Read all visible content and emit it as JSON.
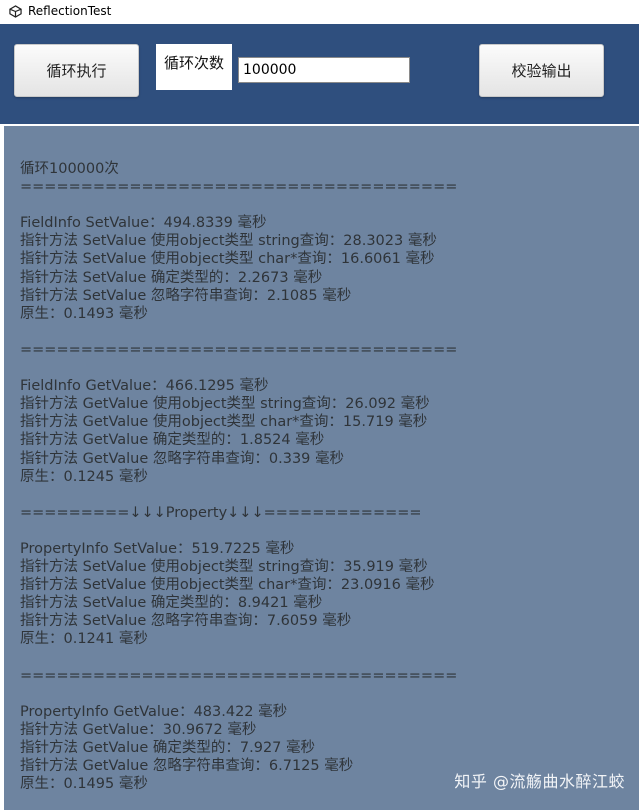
{
  "window": {
    "title": "ReflectionTest",
    "icon": "unity-logo-icon"
  },
  "toolbar": {
    "run_label": "循环执行",
    "count_label": "循环次数",
    "count_value": "100000",
    "verify_label": "校验输出"
  },
  "output": {
    "lines": [
      "循环100000次",
      "====================================",
      "",
      "FieldInfo SetValue：494.8339 毫秒",
      "指针方法 SetValue 使用object类型 string查询：28.3023 毫秒",
      "指针方法 SetValue 使用object类型 char*查询：16.6061 毫秒",
      "指针方法 SetValue 确定类型的：2.2673 毫秒",
      "指针方法 SetValue 忽略字符串查询：2.1085 毫秒",
      "原生：0.1493 毫秒",
      "",
      "====================================",
      "",
      "FieldInfo GetValue：466.1295 毫秒",
      "指针方法 GetValue 使用object类型 string查询：26.092 毫秒",
      "指针方法 GetValue 使用object类型 char*查询：15.719 毫秒",
      "指针方法 GetValue 确定类型的：1.8524 毫秒",
      "指针方法 GetValue 忽略字符串查询：0.339 毫秒",
      "原生：0.1245 毫秒",
      "",
      "=========↓↓↓Property↓↓↓=============",
      "",
      "PropertyInfo SetValue：519.7225 毫秒",
      "指针方法 SetValue 使用object类型 string查询：35.919 毫秒",
      "指针方法 SetValue 使用object类型 char*查询：23.0916 毫秒",
      "指针方法 SetValue 确定类型的：8.9421 毫秒",
      "指针方法 SetValue 忽略字符串查询：7.6059 毫秒",
      "原生：0.1241 毫秒",
      "",
      "====================================",
      "",
      "PropertyInfo GetValue：483.422 毫秒",
      "指针方法 GetValue：30.9672 毫秒",
      "指针方法 GetValue 确定类型的：7.927 毫秒",
      "指针方法 GetValue 忽略字符串查询：6.7125 毫秒",
      "原生：0.1495 毫秒"
    ]
  },
  "watermark": {
    "text": "知乎 @流觞曲水醉江蛟"
  },
  "colors": {
    "topbar": "#2f4f7e",
    "panel": "#6e84a0",
    "text": "#2f3439"
  }
}
